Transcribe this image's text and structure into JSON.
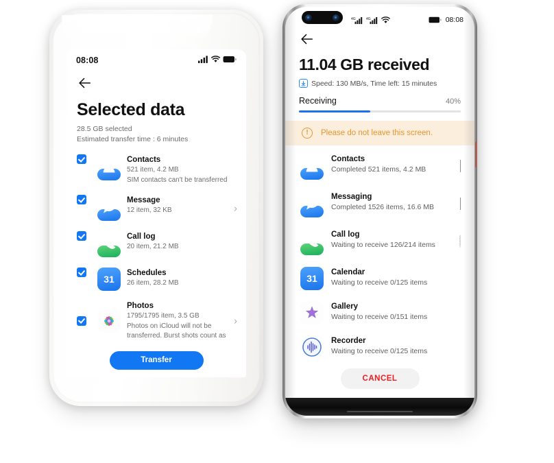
{
  "left_phone": {
    "status_bar": {
      "time": "08:08",
      "signal_icon": "cellular-bars-icon",
      "wifi_icon": "wifi-icon",
      "battery_icon": "battery-icon"
    },
    "back_icon": "back-arrow-icon",
    "title": "Selected data",
    "subtitle_size": "28.5 GB selected",
    "subtitle_time": "Estimated transfer time : 6 minutes",
    "items": [
      {
        "icon": "contacts-icon",
        "name": "Contacts",
        "meta1": "521 item, 4.2 MB",
        "meta2": "SIM contacts can't be transferred",
        "checked": true,
        "chevron": false
      },
      {
        "icon": "message-icon",
        "name": "Message",
        "meta1": "12 item, 32 KB",
        "meta2": "",
        "checked": true,
        "chevron": true
      },
      {
        "icon": "call-log-icon",
        "name": "Call log",
        "meta1": "20 item, 21.2 MB",
        "meta2": "",
        "checked": true,
        "chevron": false
      },
      {
        "icon": "calendar-icon",
        "name": "Schedules",
        "meta1": "26 item, 28.2 MB",
        "meta2": "",
        "checked": true,
        "chevron": false,
        "badge": "31"
      },
      {
        "icon": "photos-icon",
        "name": "Photos",
        "meta1": "1795/1795 item, 3.5 GB",
        "meta2": "Photos on iCloud will not be",
        "meta3": "transferred. Burst shots count as",
        "checked": true,
        "chevron": true
      }
    ],
    "transfer_button": "Transfer"
  },
  "right_phone": {
    "status_bar": {
      "time": "08:08",
      "signal_icon_1": "cellular-bars-icon",
      "signal_icon_2": "cellular-bars-icon",
      "wifi_icon": "wifi-icon",
      "battery_icon": "battery-icon",
      "camera_icon": "front-camera-cutout"
    },
    "back_icon": "back-arrow-icon",
    "title": "11.04 GB received",
    "speed_badge_icon": "download-icon",
    "speed_text": "Speed: 130 MB/s, Time left: 15 minutes",
    "tab_label": "Receiving",
    "percent_label": "40%",
    "progress_percent": 44,
    "banner": {
      "icon": "warning-exclamation-icon",
      "text": "Please do not leave this screen."
    },
    "items": [
      {
        "icon": "contacts-icon",
        "name": "Contacts",
        "meta": "Completed 521 items, 4.2 MB",
        "status": "check"
      },
      {
        "icon": "message-icon",
        "name": "Messaging",
        "meta": "Completed 1526 items, 16.6 MB",
        "status": "check"
      },
      {
        "icon": "call-log-icon",
        "name": "Call log",
        "meta": "Waiting to receive 126/214 items",
        "status": "spinner"
      },
      {
        "icon": "calendar-icon",
        "name": "Calendar",
        "meta": "Waiting to receive 0/125 items",
        "status": "none",
        "badge": "31"
      },
      {
        "icon": "gallery-icon",
        "name": "Gallery",
        "meta": "Waiting to receive 0/151 items",
        "status": "none"
      },
      {
        "icon": "recorder-icon",
        "name": "Recorder",
        "meta": "Waiting to receive  0/125 items",
        "status": "none"
      }
    ],
    "cancel_button": "CANCEL"
  },
  "colors": {
    "accent_blue": "#1277f2",
    "progress_blue": "#1a73e8",
    "warning_orange": "#e8952c",
    "banner_bg": "#fbeedd",
    "cancel_red": "#ee1d23",
    "green": "#18b05a"
  }
}
